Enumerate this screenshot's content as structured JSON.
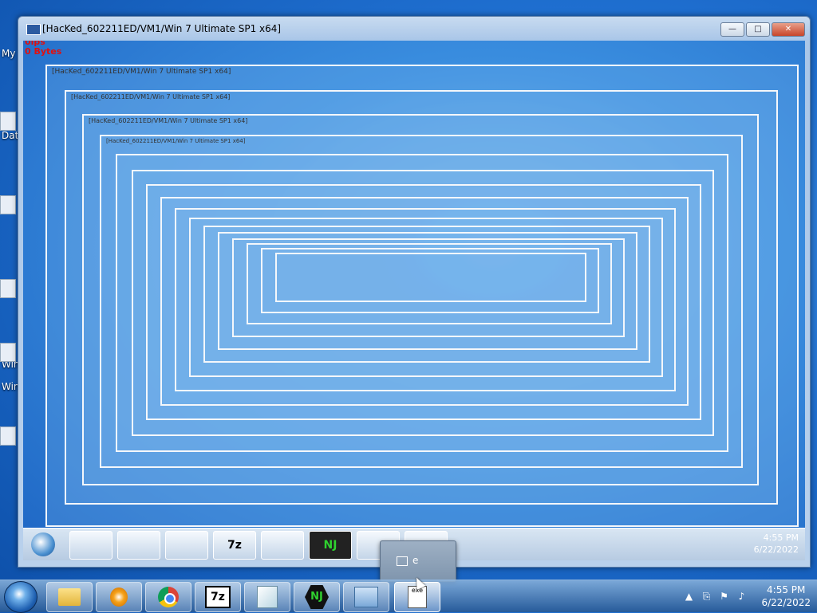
{
  "window": {
    "title": "[HacKed_602211ED/VM1/Win 7 Ultimate SP1 x64]",
    "minimize_glyph": "—",
    "maximize_glyph": "□",
    "close_glyph": "✕"
  },
  "overlay": {
    "line1": "0ips",
    "line2": "0 Bytes"
  },
  "desktop_labels": [
    "My",
    "Dat",
    "Win",
    "Win"
  ],
  "inner_taskbar": {
    "items": [
      "",
      "",
      "",
      "7z",
      "",
      "NJ",
      "",
      ""
    ],
    "time": "4:55 PM",
    "date": "6/22/2022"
  },
  "popup": {
    "label": "e"
  },
  "taskbar": {
    "items": [
      {
        "name": "explorer",
        "icon": "folder-icon"
      },
      {
        "name": "media",
        "icon": "media-player-icon"
      },
      {
        "name": "chrome",
        "icon": "chrome-icon"
      },
      {
        "name": "7zip",
        "icon": "7zip-icon",
        "text": "7z"
      },
      {
        "name": "notepad",
        "icon": "notepad-icon"
      },
      {
        "name": "nj",
        "icon": "njrat-icon",
        "text": "NJ"
      },
      {
        "name": "network",
        "icon": "network-icon"
      },
      {
        "name": "app",
        "icon": "app-icon",
        "text": "exe"
      }
    ],
    "tray": {
      "time": "4:55 PM",
      "date": "6/22/2022"
    }
  },
  "colors": {
    "desktop": "#1f6fd0",
    "overlay_text": "#e01010",
    "nj_green": "#2fd12f"
  }
}
